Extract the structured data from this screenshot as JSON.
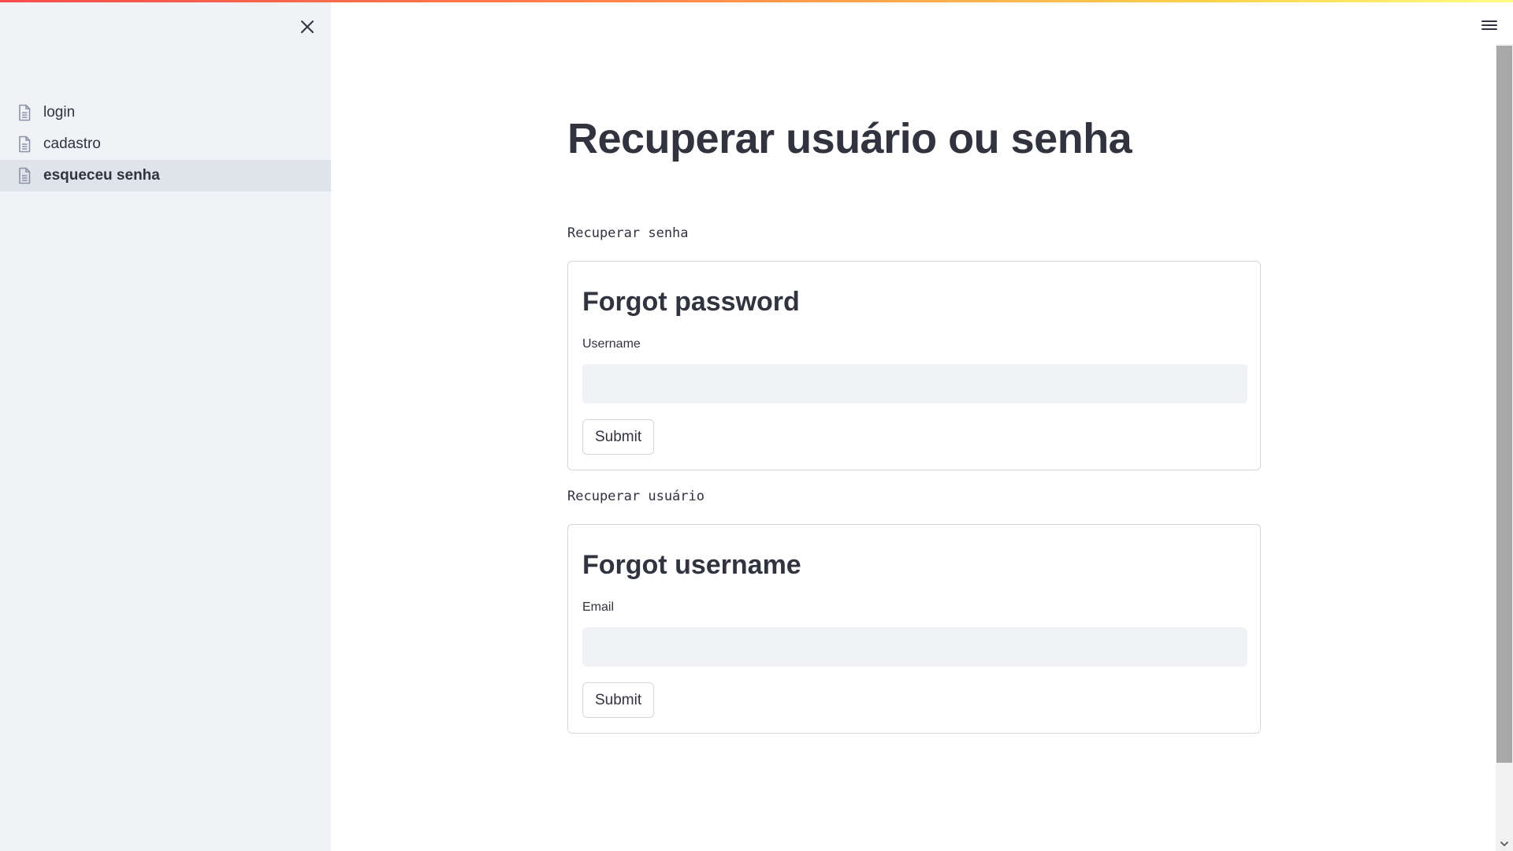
{
  "sidebar": {
    "items": [
      {
        "label": "login",
        "active": false
      },
      {
        "label": "cadastro",
        "active": false
      },
      {
        "label": "esqueceu senha",
        "active": true
      }
    ]
  },
  "main": {
    "title": "Recuperar usuário ou senha",
    "sections": [
      {
        "label": "Recuperar senha",
        "form_title": "Forgot password",
        "field_label": "Username",
        "field_value": "",
        "submit_label": "Submit"
      },
      {
        "label": "Recuperar usuário",
        "form_title": "Forgot username",
        "field_label": "Email",
        "field_value": "",
        "submit_label": "Submit"
      }
    ]
  },
  "colors": {
    "sidebar_bg": "#f0f2f6",
    "active_item_bg": "#dfe3ea",
    "text": "#31333f",
    "input_bg": "#f0f2f6"
  },
  "icons": {
    "close": "close-icon",
    "menu": "hamburger-menu-icon",
    "page": "document-icon"
  }
}
